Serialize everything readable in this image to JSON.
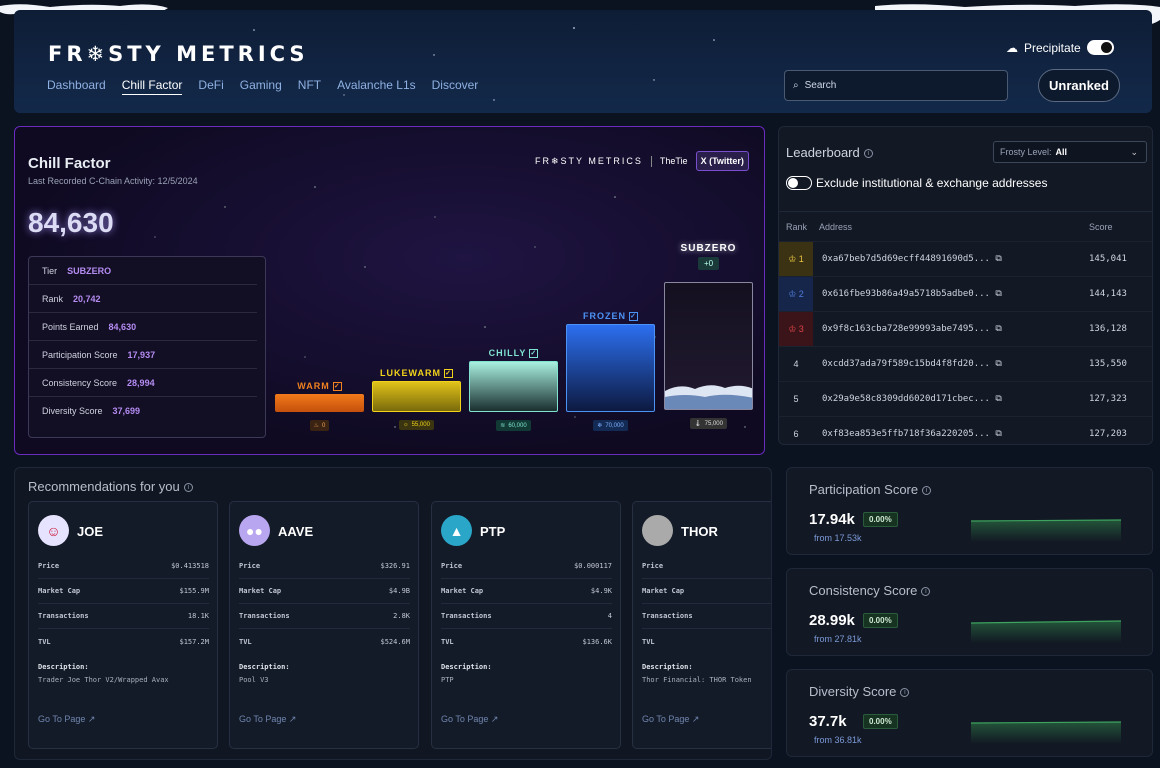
{
  "header": {
    "logo": "FR❄STY METRICS",
    "nav": [
      "Dashboard",
      "Chill Factor",
      "DeFi",
      "Gaming",
      "NFT",
      "Avalanche L1s",
      "Discover"
    ],
    "active_nav": "Chill Factor",
    "precipitate_label": "Precipitate",
    "precipitate_on": true,
    "search_placeholder": "Search",
    "rank_button": "Unranked"
  },
  "chill": {
    "title": "Chill Factor",
    "subtitle": "Last Recorded C-Chain Activity: 12/5/2024",
    "score": "84,630",
    "brand": "FR❄STY METRICS",
    "partner": "TheTie",
    "x_button": "X (Twitter)",
    "stats": [
      {
        "label": "Tier",
        "value": "SUBZERO"
      },
      {
        "label": "Rank",
        "value": "20,742"
      },
      {
        "label": "Points Earned",
        "value": "84,630"
      },
      {
        "label": "Participation Score",
        "value": "17,937"
      },
      {
        "label": "Consistency Score",
        "value": "28,994"
      },
      {
        "label": "Diversity Score",
        "value": "37,699"
      }
    ],
    "tiers": [
      {
        "name": "WARM",
        "threshold": "0"
      },
      {
        "name": "LUKEWARM",
        "threshold": "55,000"
      },
      {
        "name": "CHILLY",
        "threshold": "60,000"
      },
      {
        "name": "FROZEN",
        "threshold": "70,000"
      },
      {
        "name": "SUBZERO",
        "threshold": "75,000",
        "delta": "+0"
      }
    ]
  },
  "leaderboard": {
    "title": "Leaderboard",
    "filter_label": "Frosty Level:",
    "filter_value": "All",
    "exclude_label": "Exclude institutional & exchange addresses",
    "columns": [
      "Rank",
      "Address",
      "Score"
    ],
    "rows": [
      {
        "rank": "1",
        "address": "0xa67beb7d5d69ecff44891690d5...",
        "score": "145,041"
      },
      {
        "rank": "2",
        "address": "0x616fbe93b86a49a5718b5adbe0...",
        "score": "144,143"
      },
      {
        "rank": "3",
        "address": "0x9f8c163cba728e99993abe7495...",
        "score": "136,128"
      },
      {
        "rank": "4",
        "address": "0xcdd37ada79f589c15bd4f8fd20...",
        "score": "135,550"
      },
      {
        "rank": "5",
        "address": "0x29a9e58c8309dd6020d171cbec...",
        "score": "127,323"
      },
      {
        "rank": "6",
        "address": "0xf83ea853e5ffb718f36a220205...",
        "score": "127,203"
      }
    ],
    "colors": {
      "gold": "#e8c341",
      "silver": "#4f7bd8",
      "bronze": "#d9444a"
    }
  },
  "recommendations": {
    "title": "Recommendations for you",
    "labels": {
      "price": "Price",
      "market_cap": "Market Cap",
      "transactions": "Transactions",
      "tvl": "TVL",
      "description": "Description:",
      "go": "Go To Page"
    },
    "cards": [
      {
        "name": "JOE",
        "price": "$0.413518",
        "market_cap": "$155.9M",
        "transactions": "18.1K",
        "tvl": "$157.2M",
        "description": "Trader Joe Thor V2/Wrapped Avax",
        "avatar_color": "#e6e3ff"
      },
      {
        "name": "AAVE",
        "price": "$326.91",
        "market_cap": "$4.9B",
        "transactions": "2.8K",
        "tvl": "$524.6M",
        "description": "Pool V3",
        "avatar_color": "#b8a6f0"
      },
      {
        "name": "PTP",
        "price": "$0.000117",
        "market_cap": "$4.9K",
        "transactions": "4",
        "tvl": "$136.6K",
        "description": "PTP",
        "avatar_color": "#2aa6c9"
      },
      {
        "name": "THOR",
        "price": "",
        "market_cap": "",
        "transactions": "",
        "tvl": "",
        "description": "Thor Financial: THOR Token",
        "avatar_color": "#aaaaaa"
      }
    ]
  },
  "scores": [
    {
      "title": "Participation Score",
      "value": "17.94k",
      "change": "0.00%",
      "from": "from 17.53k"
    },
    {
      "title": "Consistency Score",
      "value": "28.99k",
      "change": "0.00%",
      "from": "from 27.81k"
    },
    {
      "title": "Diversity Score",
      "value": "37.7k",
      "change": "0.00%",
      "from": "from 36.81k"
    }
  ]
}
